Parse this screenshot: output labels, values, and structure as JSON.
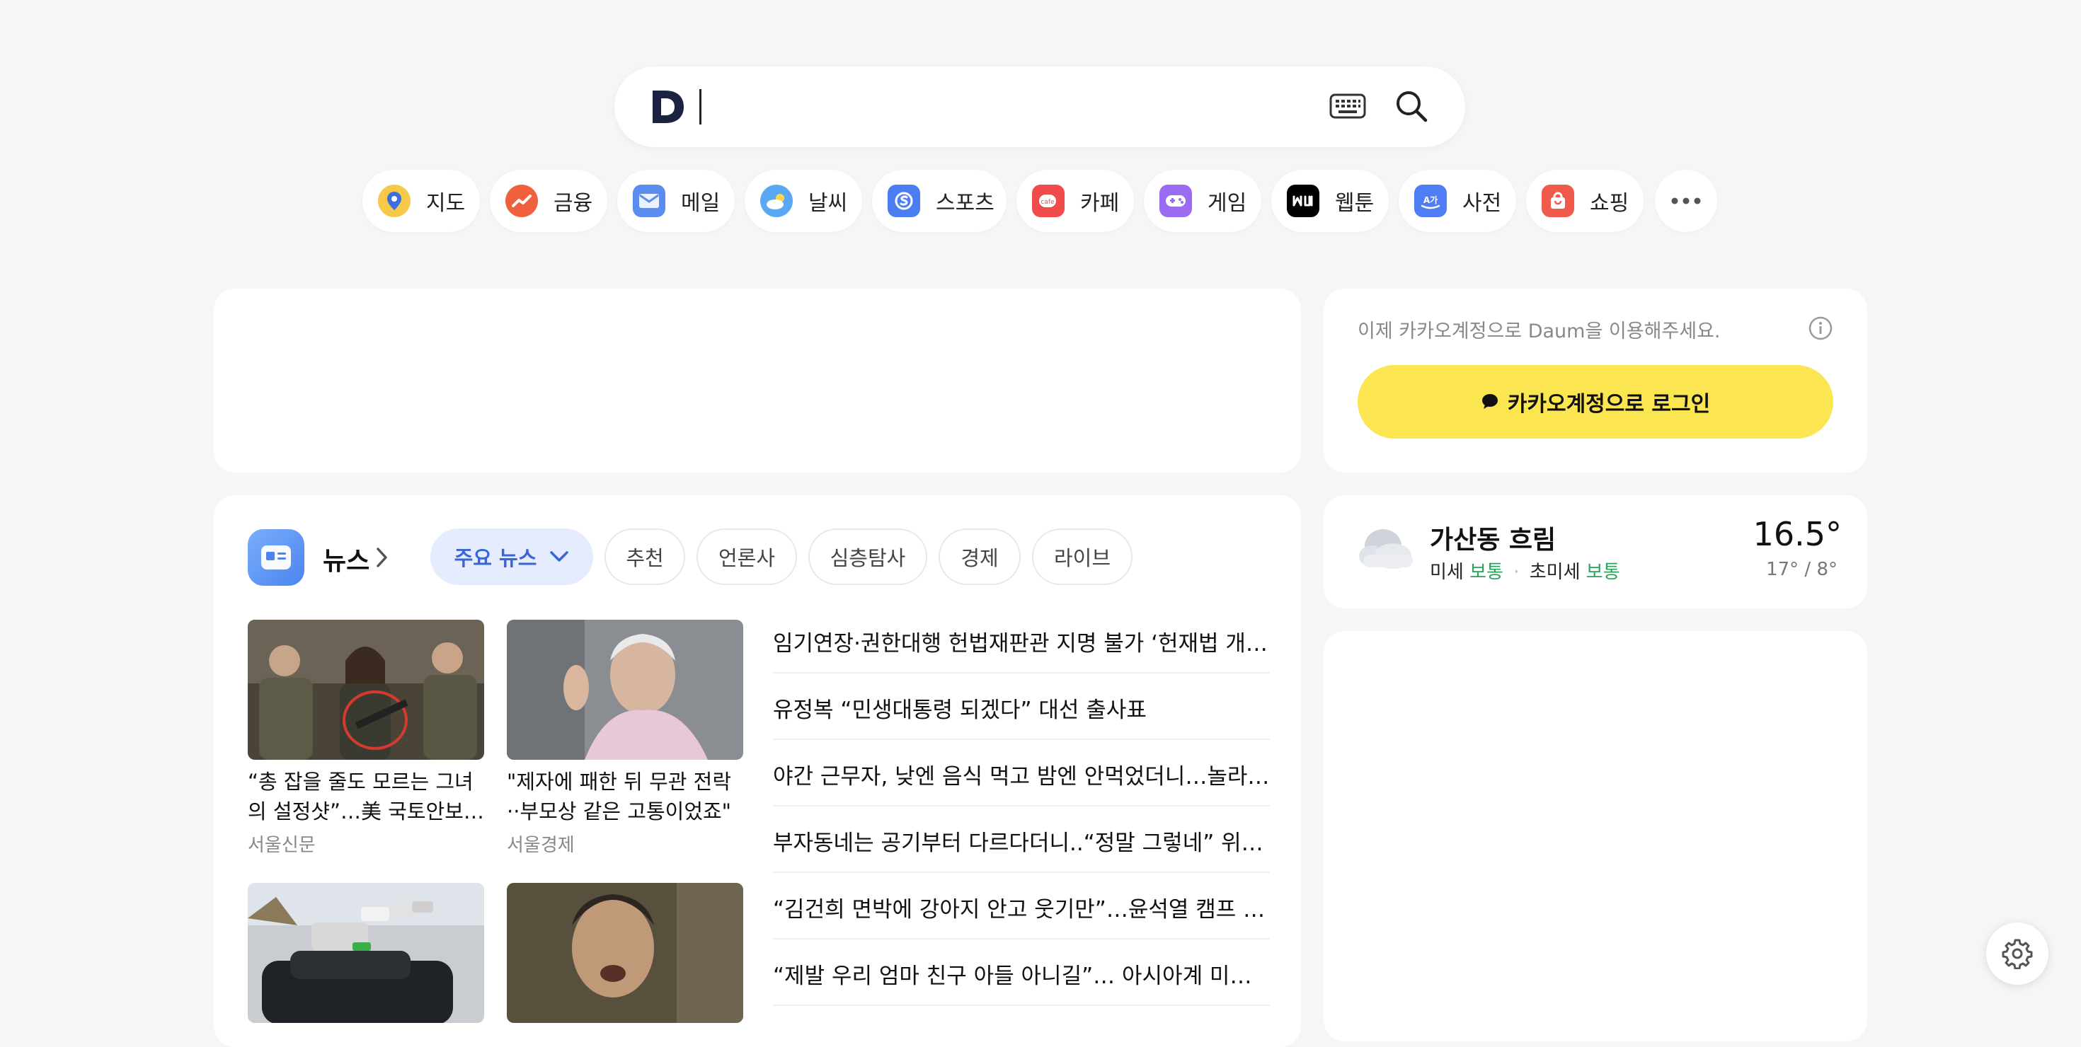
{
  "search": {
    "placeholder": "",
    "logo_icon": "daum-logo-icon",
    "keyboard_icon": "keyboard-icon",
    "search_icon": "search-icon"
  },
  "shortcuts": [
    {
      "label": "지도",
      "icon": "map-pin-icon",
      "color": "#f7c948"
    },
    {
      "label": "금융",
      "icon": "finance-chart-icon",
      "color": "#f0603c"
    },
    {
      "label": "메일",
      "icon": "mail-icon",
      "color": "#5b8def"
    },
    {
      "label": "날씨",
      "icon": "weather-icon",
      "color": "#5aa8f5"
    },
    {
      "label": "스포츠",
      "icon": "sports-icon",
      "color": "#4c7ef3"
    },
    {
      "label": "카페",
      "icon": "cafe-icon",
      "color": "#ef4b4b"
    },
    {
      "label": "게임",
      "icon": "game-icon",
      "color": "#9b6bf2"
    },
    {
      "label": "웹툰",
      "icon": "webtoon-icon",
      "color": "#000000"
    },
    {
      "label": "사전",
      "icon": "dictionary-icon",
      "color": "#4f7df5"
    },
    {
      "label": "쇼핑",
      "icon": "shopping-bag-icon",
      "color": "#f05a4a"
    }
  ],
  "more_icon": "more-dots-icon",
  "login": {
    "notice": "이제 카카오계정으로 Daum을 이용해주세요.",
    "button": "카카오계정으로 로그인",
    "button_color": "#fbe551"
  },
  "weather": {
    "location": "가산동 흐림",
    "dust_label": "미세",
    "dust_value": "보통",
    "fine_dust_label": "초미세",
    "fine_dust_value": "보통",
    "temp": "16.5°",
    "range": "17° / 8°",
    "status_color": "#29a35a"
  },
  "news": {
    "title": "뉴스",
    "tabs": [
      "주요 뉴스",
      "추천",
      "언론사",
      "심층탐사",
      "경제",
      "라이브"
    ],
    "cards": [
      {
        "title": "“총 잡을 줄도 모르는 그녀의 설정샷”…美 국토안보…",
        "source": "서울신문"
      },
      {
        "title": "\"제자에 패한 뒤 무관 전락··부모상 같은 고통이었죠\"",
        "source": "서울경제"
      }
    ],
    "headlines": [
      "임기연장·권한대행 헌법재판관 지명 불가 ‘헌재법 개정안’ 국회 통과",
      "유정복 “민생대통령 되겠다” 대선 출사표",
      "야간 근무자, 낮엔 음식 먹고 밤엔 안먹었더니…놀라운 결과",
      "부자동네는 공기부터 다르다더니..“정말 그렇네” 위성사진 분석",
      "“김건희 면박에 강아지 안고 웃기만”…윤석열 캠프 대변인 회고",
      "“제발 우리 엄마 친구 아들 아니길”… 아시아계 미국인 병사"
    ]
  }
}
